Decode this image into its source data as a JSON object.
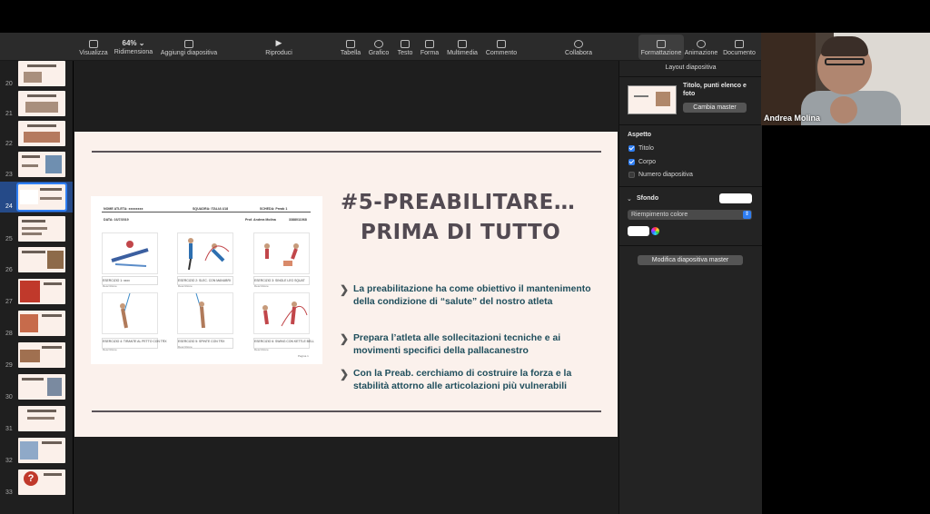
{
  "toolbar": {
    "view": "Visualizza",
    "zoom": "64%",
    "resize": "Ridimensiona",
    "add_slide": "Aggiungi diapositiva",
    "play": "Riproduci",
    "table": "Tabella",
    "chart": "Grafico",
    "text": "Testo",
    "shape": "Forma",
    "media": "Multimedia",
    "comment": "Commento",
    "collaborate": "Collabora",
    "format": "Formattazione",
    "animate": "Animazione",
    "document": "Documento"
  },
  "navigator": {
    "slides": [
      "20",
      "21",
      "22",
      "23",
      "24",
      "25",
      "26",
      "27",
      "28",
      "29",
      "30",
      "31",
      "32",
      "33"
    ],
    "selected": "24"
  },
  "slide": {
    "title_line1": "#5-PREABILITARE…",
    "title_line2": "PRIMA DI TUTTO",
    "bullets": [
      "La preabilitazione ha come obiettivo il mantenimento della condizione di “salute” del nostro atleta",
      "Prepara l’atleta alle sollecitazioni tecniche e ai movimenti specifici della pallacanestro",
      "Con la Preab.  cerchiamo di costruire la forza e la stabilità  attorno alle articolazioni più vulnerabili"
    ],
    "doc": {
      "nome": "NOME ATLETA: xxxxxxxx",
      "squadra": "SQUADRA: ITALIA U18",
      "scheda": "SCHEDA: Preab 1",
      "data": "DATA: 16/7/2019",
      "prof": "Prof. Andrea Molina",
      "phone": "3388011068",
      "exercises": [
        {
          "label": "ESERCIZIO 1: xxxx",
          "sub": "Descrizione"
        },
        {
          "label": "ESERCIZIO 2: SLEC. CON MANUBRI",
          "sub": "Descrizione"
        },
        {
          "label": "ESERCIZIO 3:  SINGLE LEG SQUAT",
          "sub": "Descrizione"
        },
        {
          "label": "ESERCIZIO 4: TIRANTE AL PETTO CON TRX",
          "sub": "Descrizione"
        },
        {
          "label": "ESERCIZIO 5: SPINTE CON TRX",
          "sub": "Descrizione"
        },
        {
          "label": "ESERCIZIO 6:  SWING CON KETTLE BELL",
          "sub": "Descrizione"
        }
      ],
      "page": "Pagina 1"
    }
  },
  "panel": {
    "title": "Layout diapositiva",
    "layout_name": "Titolo, punti elenco e foto",
    "change_master": "Cambia master",
    "appearance": "Aspetto",
    "opt_title": "Titolo",
    "opt_body": "Corpo",
    "opt_number": "Numero diapositiva",
    "background": "Sfondo",
    "fill": "Riempimento colore",
    "edit_master": "Modifica diapositiva master"
  },
  "video": {
    "name": "Andrea Molina"
  },
  "colors": {
    "accent": "#2f7ef2",
    "slide_bg": "#fbf1ec",
    "title": "#524a52",
    "bullet_text": "#1f4e5c"
  }
}
